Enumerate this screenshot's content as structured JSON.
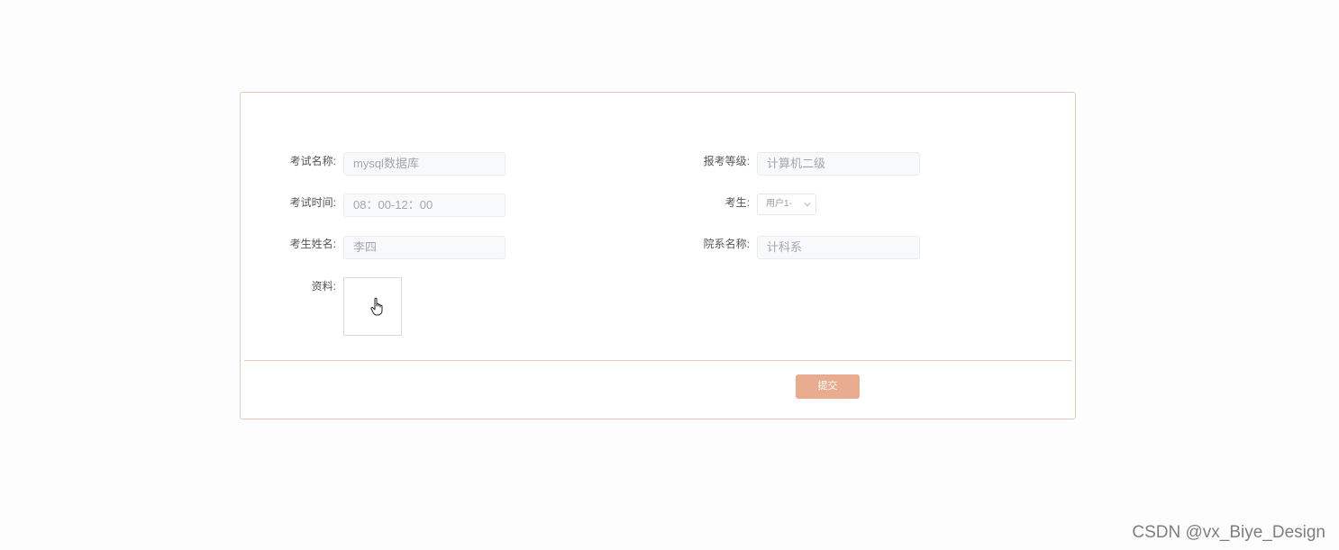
{
  "form": {
    "fields": {
      "exam_name": {
        "label": "考试名称:",
        "value": "mysql数据库"
      },
      "exam_level": {
        "label": "报考等级:",
        "value": "计算机二级"
      },
      "exam_time": {
        "label": "考试时间:",
        "value": "08：00-12：00"
      },
      "student": {
        "label": "考生:",
        "value": "用户1-"
      },
      "student_name": {
        "label": "考生姓名:",
        "value": "李四"
      },
      "department": {
        "label": "院系名称:",
        "value": "计科系"
      },
      "material": {
        "label": "资料:"
      }
    },
    "submit_label": "提交"
  },
  "watermark": "CSDN @vx_Biye_Design",
  "colors": {
    "accent": "#e9ac8e",
    "card_border": "#e7c8b8",
    "input_bg": "#f8f9fb"
  },
  "icons": {
    "select_chevron": "chevron-down-icon",
    "upload_cursor": "hand-pointer-icon"
  }
}
